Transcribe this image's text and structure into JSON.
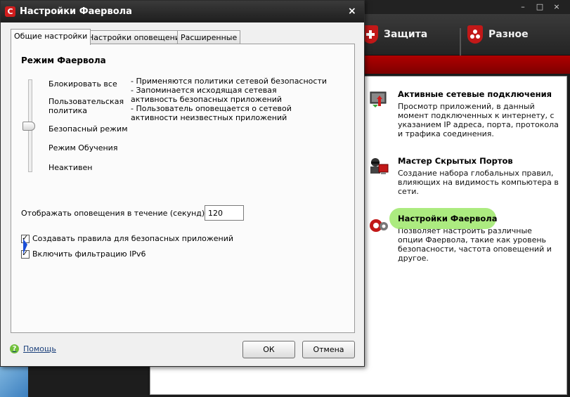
{
  "background_app": {
    "window_controls": [
      "–",
      "□",
      "×"
    ],
    "tabs": [
      {
        "label": "Защита",
        "icon": "shield-plus-icon"
      },
      {
        "label": "Разное",
        "icon": "shield-dots-icon"
      }
    ],
    "items": [
      {
        "title": "Активные сетевые подключения",
        "description": "Просмотр приложений, в данный момент подключенных к интернету, с указанием IP адреса, порта, протокола и трафика соединения.",
        "icon": "network-connections-icon"
      },
      {
        "title": "Мастер Скрытых Портов",
        "description": "Создание набора глобальных правил, влияющих на видимость компьютера в сети.",
        "icon": "stealth-ports-icon"
      },
      {
        "title": "Настройки Фаервола",
        "description": "Позволяет настроить различные опции Фаервола, такие как уровень безопасности, частота оповещений и другое.",
        "icon": "firewall-settings-icon"
      }
    ]
  },
  "dialog": {
    "logo": "C",
    "title": "Настройки Фаервола",
    "close": "×",
    "tabs": [
      "Общие настройки",
      "Настройки оповещений",
      "Расширенные"
    ],
    "mode_title": "Режим Фаервола",
    "levels": [
      "Блокировать все",
      "Пользовательская политика",
      "Безопасный режим",
      "Режим Обучения",
      "Неактивен"
    ],
    "selected_level": "Безопасный режим",
    "description_lines": [
      "- Применяются политики сетевой безопасности",
      "- Запоминается исходящая сетевая активность безопасных приложений",
      "- Пользователь оповещается о сетевой активности неизвестных приложений"
    ],
    "notify_label": "Отображать оповещения в течение (секунд):",
    "notify_value": "120",
    "checkboxes": [
      {
        "label": "Создавать правила для безопасных приложений",
        "checked": true
      },
      {
        "label": "Включить фильтрацию IPv6",
        "checked": true
      }
    ],
    "help_label": "Помощь",
    "ok_label": "ОК",
    "cancel_label": "Отмена"
  },
  "colors": {
    "accent_red": "#b00000",
    "highlight_green": "#9ee86a"
  }
}
